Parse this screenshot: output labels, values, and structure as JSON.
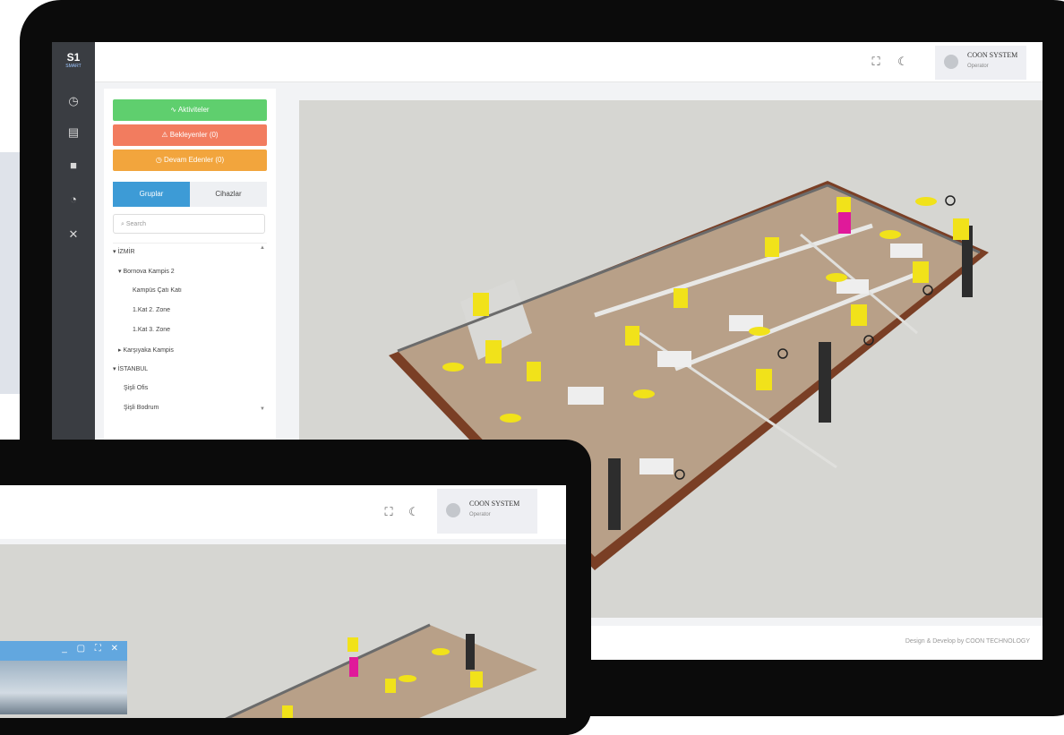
{
  "app": {
    "logo": "S1",
    "logo_sub": "SMART"
  },
  "header": {
    "user_name": "COON SYSTEM",
    "user_role": "Operator"
  },
  "actions": {
    "activities": "Aktiviteler",
    "pending": "Bekleyenler (0)",
    "ongoing": "Devam Edenler (0)"
  },
  "tabs": {
    "groups": "Gruplar",
    "devices": "Cihazlar"
  },
  "search": {
    "placeholder": "Search"
  },
  "tree": [
    {
      "label": "İZMİR"
    },
    {
      "label": "Bornova Kampis 2"
    },
    {
      "label": "Kampüs Çatı Katı"
    },
    {
      "label": "1.Kat 2. Zone"
    },
    {
      "label": "1.Kat 3. Zone"
    },
    {
      "label": "Karşıyaka Kampis"
    },
    {
      "label": "İSTANBUL"
    },
    {
      "label": "Şişli Ofis"
    },
    {
      "label": "Şişli Bodrum"
    }
  ],
  "footer": {
    "credit": "Design & Develop by COON TECHNOLOGY"
  },
  "front": {
    "user_name": "COON SYSTEM",
    "user_role": "Operator"
  },
  "colors": {
    "green": "#5fcf6e",
    "red": "#f27c5f",
    "orange": "#f2a53d",
    "blue": "#3d9bd6",
    "rail": "#3a3d42",
    "sensor": "#f1e21a",
    "magenta": "#e0199a"
  },
  "icons": [
    "dashboard-icon",
    "id-card-icon",
    "cube-icon",
    "clock-icon",
    "tools-icon",
    "fullscreen-icon",
    "moon-icon",
    "user-icon",
    "activity-icon",
    "warning-icon",
    "clock-circle-icon",
    "search-icon"
  ]
}
